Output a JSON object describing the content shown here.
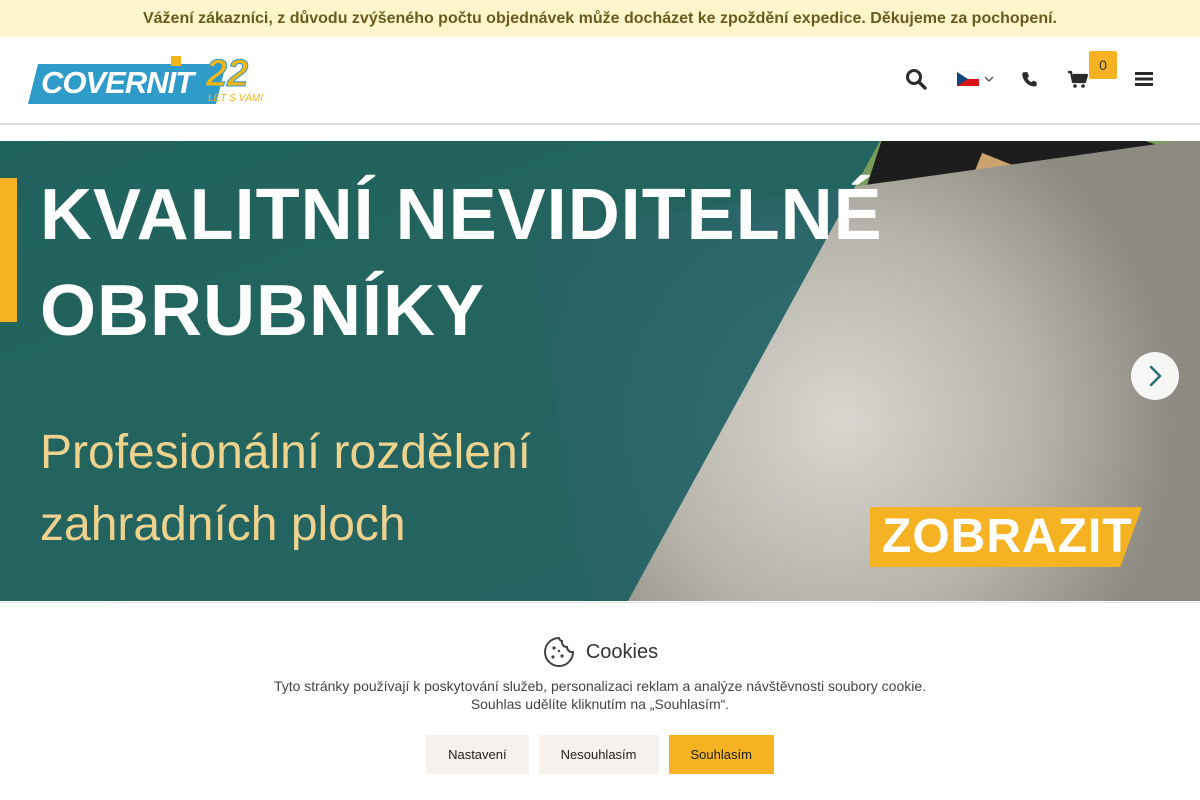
{
  "notice": "Vážení zákazníci, z důvodu zvýšeného počtu objednávek může docházet ke zpoždění expedice. Děkujeme za pochopení.",
  "header": {
    "logo_text": "COVERNIT",
    "logo_number": "22",
    "logo_tagline": "LET S VÁMI",
    "cart_count": "0",
    "icons": [
      "search-icon",
      "flag-cz-icon",
      "chevron-down-icon",
      "phone-icon",
      "cart-icon",
      "menu-icon"
    ]
  },
  "hero": {
    "headline_line1": "KVALITNÍ NEVIDITELNÉ",
    "headline_line2": "OBRUBNÍKY",
    "sub_line1": "Profesionální rozdělení",
    "sub_line2": "zahradních ploch",
    "cta": "ZOBRAZIT"
  },
  "cookies": {
    "title": "Cookies",
    "text_line1": "Tyto stránky používají k poskytování služeb, personalizaci reklam a analýze návštěvnosti soubory cookie.",
    "text_line2": "Souhlas udělíte kliknutím na „Souhlasím“.",
    "btn_settings": "Nastavení",
    "btn_decline": "Nesouhlasím",
    "btn_accept": "Souhlasím"
  },
  "colors": {
    "accent": "#f5b323",
    "brand_blue": "#2e9bc9",
    "hero_overlay": "#185c60",
    "notice_bg": "#fdf6cc"
  }
}
